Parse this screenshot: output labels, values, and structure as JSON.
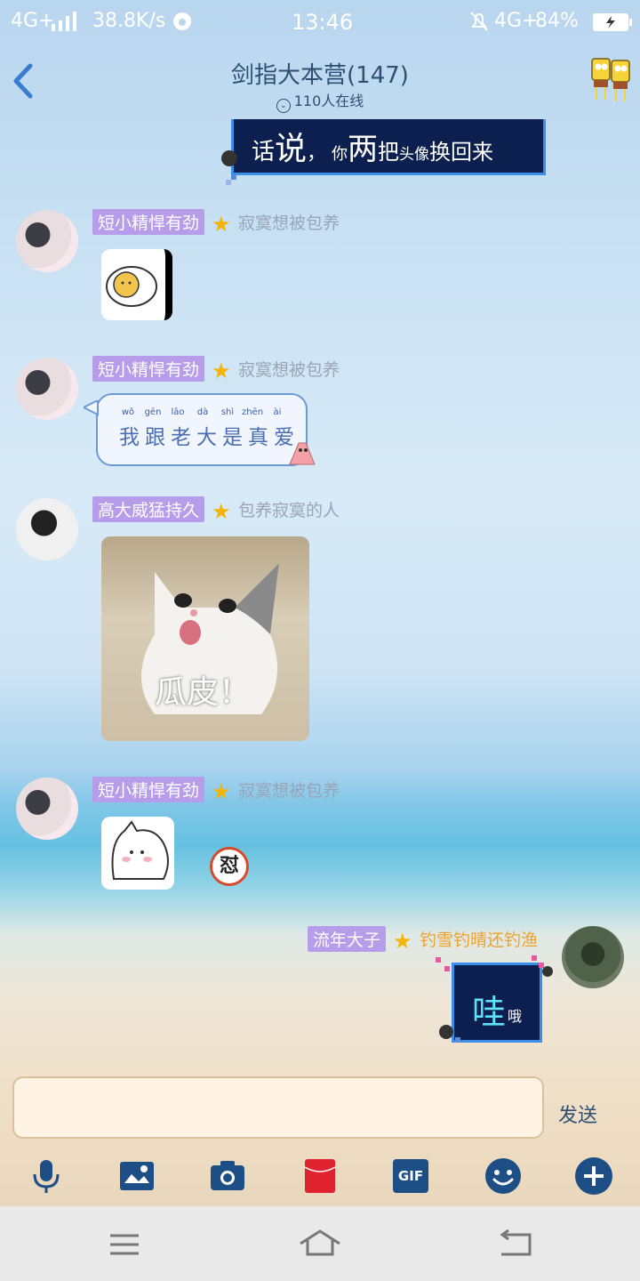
{
  "status_bar": {
    "network": "4G+",
    "speed": "38.8K/s",
    "time": "13:46",
    "network2": "4G+",
    "battery": "84%"
  },
  "nav": {
    "title": "剑指大本营(147)",
    "online": "110人在线"
  },
  "top_message": {
    "text_a": "话",
    "text_b": "说",
    "text_c": "，",
    "text_d": "你",
    "text_e": "两",
    "text_f": "把",
    "text_g": "头像",
    "text_h": "换回来"
  },
  "messages": [
    {
      "name": "短小精悍有劲",
      "title": "寂寞想被包养"
    },
    {
      "name": "短小精悍有劲",
      "title": "寂寞想被包养",
      "pinyin": [
        "wǒ",
        "gēn",
        "lǎo",
        "dà",
        "shì",
        "zhēn",
        "ài"
      ],
      "text": "我跟老大是真爱"
    },
    {
      "name": "高大威猛持久",
      "title": "包养寂寞的人",
      "sticker_caption": "瓜皮！"
    },
    {
      "name": "短小精悍有劲",
      "title": "寂寞想被包养",
      "badge": "怼"
    },
    {
      "name": "流年大子",
      "title": "钓雪钓晴还钓渔",
      "text_big": "哇",
      "text_small": "哦"
    }
  ],
  "composer": {
    "placeholder": "",
    "send_label": "发送"
  },
  "toolbar": [
    "mic-icon",
    "photo-icon",
    "camera-icon",
    "red-packet-icon",
    "gif-icon",
    "emoji-icon",
    "plus-icon"
  ],
  "gif_label": "GIF",
  "colors": {
    "nav_text": "#2f4f73",
    "name_tag": "#b79cea",
    "title_gray": "#9aa4b8",
    "title_orange": "#f0a12a",
    "dark_bubble": "#0c1f4e",
    "toolbar_blue": "#1d4e86",
    "red_packet": "#e0222e"
  }
}
